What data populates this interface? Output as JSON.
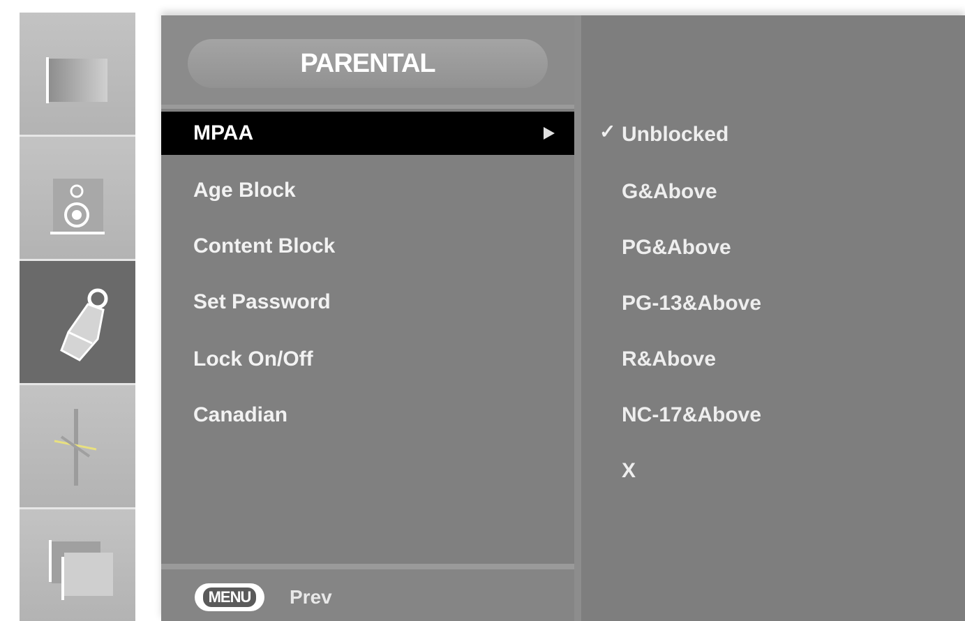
{
  "sidebar": {
    "items": [
      {
        "name": "picture",
        "icon": "picture-frame-icon"
      },
      {
        "name": "audio",
        "icon": "speaker-icon"
      },
      {
        "name": "parental",
        "icon": "lock-icon",
        "active": true
      },
      {
        "name": "setup",
        "icon": "antenna-icon"
      },
      {
        "name": "option",
        "icon": "screen-option-icon"
      }
    ]
  },
  "panel": {
    "title": "PARENTAL",
    "menu": [
      {
        "label": "MPAA",
        "selected": true
      },
      {
        "label": "Age Block",
        "selected": false
      },
      {
        "label": "Content Block",
        "selected": false
      },
      {
        "label": "Set Password",
        "selected": false
      },
      {
        "label": "Lock On/Off",
        "selected": false
      },
      {
        "label": "Canadian",
        "selected": false
      }
    ],
    "footer": {
      "button": "MENU",
      "label": "Prev"
    },
    "options": {
      "checked_mark": "✓",
      "items": [
        "Unblocked",
        "G&Above",
        "PG&Above",
        "PG-13&Above",
        "R&Above",
        "NC-17&Above",
        "X"
      ]
    }
  },
  "colors": {
    "panel_bg": "#7f7f7f",
    "selected_bg": "#000000",
    "text": "#f2f2f2",
    "sidebar_active": "#6a6a6a"
  }
}
